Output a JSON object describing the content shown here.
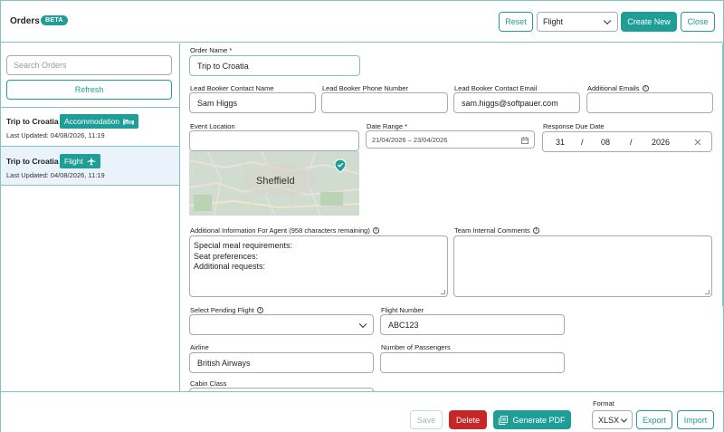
{
  "header": {
    "title": "Orders",
    "badge": "BETA",
    "reset_label": "Reset",
    "type_select": {
      "value": "Flight"
    },
    "create_label": "Create New",
    "close_label": "Close"
  },
  "sidebar": {
    "search_placeholder": "Search Orders",
    "refresh_label": "Refresh",
    "orders": [
      {
        "name": "Trip to Croatia",
        "tag": "Accommodation",
        "icon": "bed-icon",
        "updated": "Last Updated: 04/08/2026, 11:19",
        "selected": false
      },
      {
        "name": "Trip to Croatia",
        "tag": "Flight",
        "icon": "plane-icon",
        "updated": "Last Updated: 04/08/2026, 11:19",
        "selected": true
      }
    ]
  },
  "form": {
    "order_name": {
      "label": "Order Name *",
      "value": "Trip to Croatia"
    },
    "lead_name": {
      "label": "Lead Booker Contact Name",
      "value": "Sam Higgs"
    },
    "lead_phone": {
      "label": "Lead Booker Phone Number",
      "value": ""
    },
    "lead_email": {
      "label": "Lead Booker Contact Email",
      "value": "sam.higgs@softpauer.com"
    },
    "additional_emails": {
      "label": "Additional Emails",
      "value": ""
    },
    "event_location": {
      "label": "Event Location",
      "value": "",
      "map_label": "Sheffield"
    },
    "date_range": {
      "label": "Date Range *",
      "value": "21/04/2026 – 23/04/2026"
    },
    "response_due": {
      "label": "Response Due Date",
      "day": "31",
      "sep": "/",
      "month": "08",
      "year": "2026"
    },
    "agent_info": {
      "label": "Additional Information For Agent (958 characters remaining)",
      "lines": [
        "Special meal requirements:",
        "Seat preferences:",
        "Additional requests:"
      ]
    },
    "team_comments": {
      "label": "Team Internal Comments",
      "value": ""
    },
    "pending_flight": {
      "label": "Select Pending Flight",
      "value": ""
    },
    "flight_number": {
      "label": "Flight Number",
      "value": "ABC123"
    },
    "airline": {
      "label": "Airline",
      "value": "British Airways"
    },
    "passengers": {
      "label": "Number of Passengers",
      "value": ""
    },
    "cabin_class": {
      "label": "Cabin Class"
    }
  },
  "footer": {
    "save_label": "Save",
    "delete_label": "Delete",
    "pdf_label": "Generate PDF",
    "format_label": "Format",
    "format_value": "XLSX",
    "export_label": "Export",
    "import_label": "Import"
  },
  "colors": {
    "accent": "#1f9e97",
    "danger": "#c72626",
    "border": "#7fc3c3",
    "selected_bg": "#eaf2fb"
  }
}
